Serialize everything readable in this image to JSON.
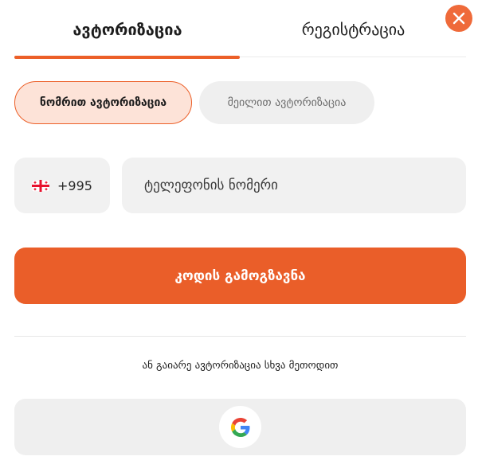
{
  "tabs": {
    "login_label": "ავტორიზაცია",
    "register_label": "რეგისტრაცია",
    "active": "login"
  },
  "close_button": {
    "icon": "close-icon"
  },
  "auth_methods": {
    "phone_label": "ნომრით ავტორიზაცია",
    "email_label": "მეილით ავტორიზაცია",
    "active": "phone"
  },
  "phone_form": {
    "country_flag_icon": "georgia-flag-icon",
    "country_code": "+995",
    "phone_placeholder": "ტელეფონის ნომერი",
    "phone_value": ""
  },
  "submit": {
    "label": "კოდის გამოგზავნა"
  },
  "alternative": {
    "text": "ან გაიარე ავტორიზაცია სხვა მეთოდით",
    "google_icon": "google-icon"
  },
  "colors": {
    "accent": "#ec5f28",
    "accent_light": "#fde3d8",
    "field_bg": "#f1f1f1"
  }
}
